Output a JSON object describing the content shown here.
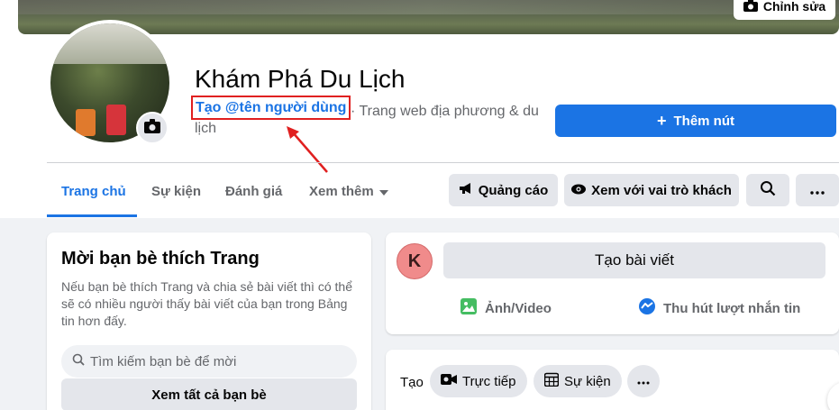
{
  "cover": {
    "edit_label": "Chỉnh sửa"
  },
  "profile": {
    "page_name": "Khám Phá Du Lịch",
    "username_link": "Tạo @tên người dùng",
    "category": "· Trang web địa phương & du lịch"
  },
  "actions": {
    "add_button": "Thêm nút"
  },
  "tabs": [
    {
      "label": "Trang chủ"
    },
    {
      "label": "Sự kiện"
    },
    {
      "label": "Đánh giá"
    },
    {
      "label": "Xem thêm"
    }
  ],
  "toolbar": {
    "ads": "Quảng cáo",
    "view_as": "Xem với vai trò khách"
  },
  "invite": {
    "title": "Mời bạn bè thích Trang",
    "description": "Nếu bạn bè thích Trang và chia sẻ bài viết thì có thể sẽ có nhiều người thấy bài viết của bạn trong Bảng tin hơn đấy.",
    "search_placeholder": "Tìm kiếm bạn bè để mời",
    "see_all": "Xem tất cả bạn bè"
  },
  "composer": {
    "avatar_letter": "K",
    "create_post": "Tạo bài viết",
    "photo_video": "Ảnh/Video",
    "messages": "Thu hút lượt nhắn tin"
  },
  "create_bar": {
    "label": "Tạo",
    "live": "Trực tiếp",
    "event": "Sự kiện"
  },
  "colors": {
    "accent": "#1b74e4",
    "highlight_border": "#e02020"
  }
}
